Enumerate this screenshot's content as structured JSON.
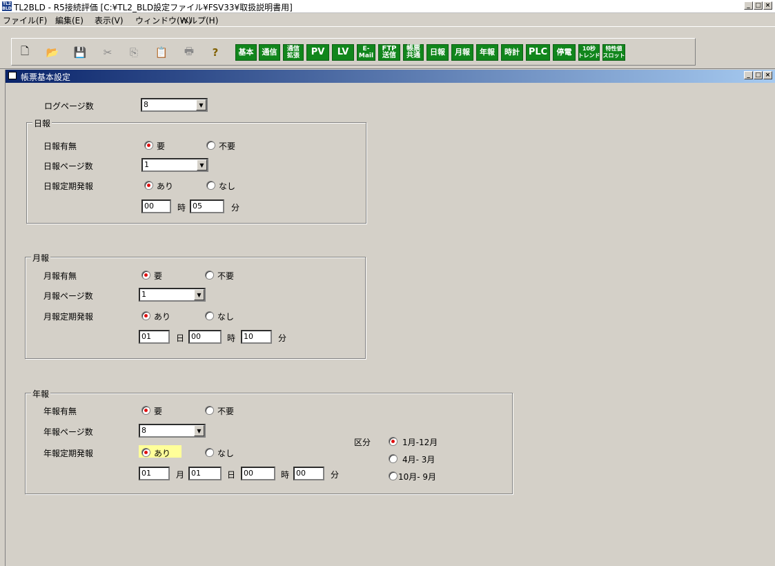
{
  "app": {
    "title": "TL2BLD - R5接続評価 [C:¥TL2_BLD設定ファイル¥FSV33¥取扱説明書用]",
    "icon_text": "TL2 BLD",
    "window_buttons": [
      "_",
      "□",
      "×"
    ]
  },
  "menu": [
    "ファイル(F)",
    "編集(E)",
    "表示(V)",
    "ウィンドウ(W)",
    "ヘルプ(H)"
  ],
  "toolbar": {
    "icons": [
      "new-icon",
      "open-icon",
      "save-icon",
      "cut-icon",
      "copy-icon",
      "paste-icon",
      "print-icon",
      "help-icon"
    ],
    "icon_glyphs": [
      "🗋",
      "📂",
      "💾",
      "✂",
      "⎘",
      "📋",
      "🖶",
      "?"
    ],
    "buttons": [
      "基本",
      "通信",
      "通信\n拡張",
      "PV",
      "LV",
      "E-\nMail",
      "FTP\n送信",
      "帳票\n共通",
      "日報",
      "月報",
      "年報",
      "時計",
      "PLC",
      "停電",
      "10秒\nトレンド",
      "特性値\nスロット"
    ]
  },
  "child_window": {
    "title": "帳票基本設定"
  },
  "form": {
    "log_pages_label": "ログページ数",
    "log_pages_value": "8",
    "daily": {
      "group_title": "日報",
      "enabled_label": "日報有無",
      "opt_yes": "要",
      "opt_no": "不要",
      "pages_label": "日報ページ数",
      "pages_value": "1",
      "periodic_label": "日報定期発報",
      "opt_on": "あり",
      "opt_off": "なし",
      "hour_value": "00",
      "hour_unit": "時",
      "minute_value": "05",
      "minute_unit": "分"
    },
    "monthly": {
      "group_title": "月報",
      "enabled_label": "月報有無",
      "opt_yes": "要",
      "opt_no": "不要",
      "pages_label": "月報ページ数",
      "pages_value": "1",
      "periodic_label": "月報定期発報",
      "opt_on": "あり",
      "opt_off": "なし",
      "day_value": "01",
      "day_unit": "日",
      "hour_value": "00",
      "hour_unit": "時",
      "minute_value": "10",
      "minute_unit": "分"
    },
    "yearly": {
      "group_title": "年報",
      "enabled_label": "年報有無",
      "opt_yes": "要",
      "opt_no": "不要",
      "pages_label": "年報ページ数",
      "pages_value": "8",
      "periodic_label": "年報定期発報",
      "opt_on": "あり",
      "opt_off": "なし",
      "month_value": "01",
      "month_unit": "月",
      "day_value": "01",
      "day_unit": "日",
      "hour_value": "00",
      "hour_unit": "時",
      "minute_value": "00",
      "minute_unit": "分",
      "division_label": "区分",
      "division_options": [
        "1月-12月",
        "4月- 3月",
        "10月- 9月"
      ]
    }
  },
  "colors": {
    "toolbar_button_green": "#11861c",
    "radio_dot": "#e01010",
    "highlight": "#ffff99"
  }
}
